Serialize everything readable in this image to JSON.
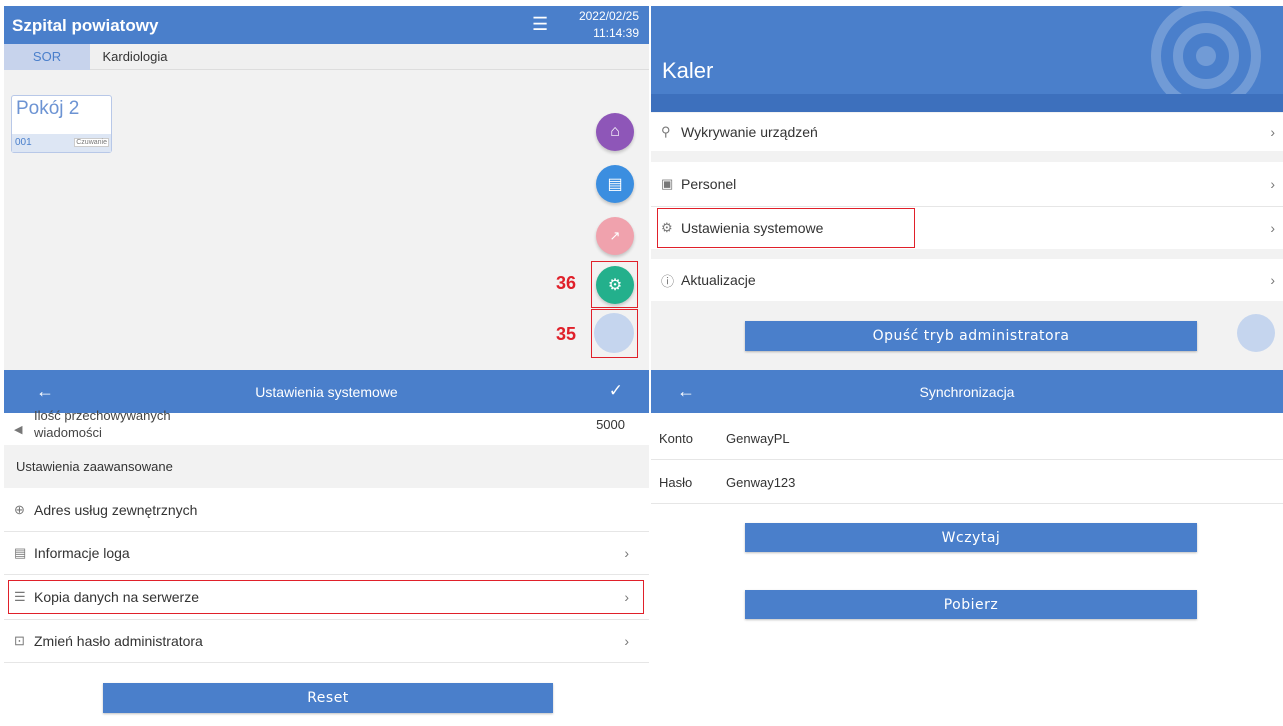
{
  "top_left": {
    "title": "Szpital powiatowy",
    "date": "2022/02/25",
    "time": "11:14:39",
    "tabs": [
      "SOR",
      "Kardiologia"
    ],
    "room": {
      "name": "Pokój 2",
      "bed": "001",
      "status": "Czuwanie"
    },
    "callouts": {
      "settings": "36",
      "blank": "35"
    },
    "fab_icons": [
      "home-icon",
      "messages-icon",
      "stats-icon",
      "settings-icon",
      "blank-circle"
    ],
    "fab_colors": [
      "#8e56b8",
      "#3b8ee0",
      "#f0a2ad",
      "#23b08c",
      "#c5d5ee"
    ]
  },
  "top_right": {
    "title": "Kaler",
    "menu": [
      "Wykrywanie urządzeń",
      "Personel",
      "Ustawienia systemowe",
      "Aktualizacje"
    ],
    "exit_label": "Opuść tryb administratora"
  },
  "bottom_left": {
    "title": "Ustawienia systemowe",
    "partial_label_top": "Ilość przechowywanych",
    "partial_label_bottom": "wiadomości",
    "partial_value": "5000",
    "section_header": "Ustawienia zaawansowane",
    "items": [
      "Adres usług zewnętrznych",
      "Informacje loga",
      "Kopia danych na serwerze",
      "Zmień hasło administratora"
    ],
    "reset_label": "Reset"
  },
  "bottom_right": {
    "title": "Synchronizacja",
    "account_label": "Konto",
    "account_value": "GenwayPL",
    "password_label": "Hasło",
    "password_value": "Genway123",
    "load_label": "Wczytaj",
    "download_label": "Pobierz"
  },
  "colors": {
    "primary": "#4a7fcb",
    "highlight": "#e0202a"
  }
}
